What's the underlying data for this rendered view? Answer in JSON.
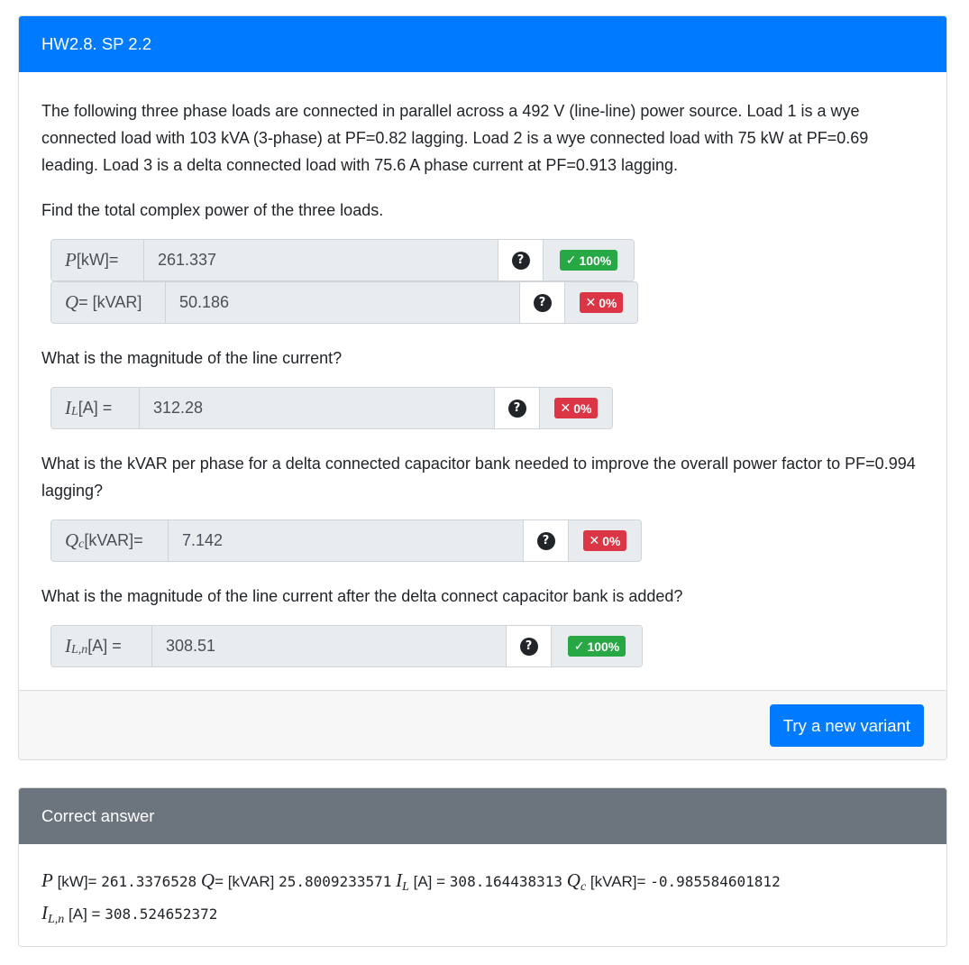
{
  "question": {
    "title": "HW2.8. SP 2.2",
    "intro": "The following three phase loads are connected in parallel across a 492 V (line-line) power source. Load 1 is a wye connected load with 103 kVA (3-phase) at PF=0.82 lagging. Load 2 is a wye connected load with 75 kW at PF=0.69 leading. Load 3 is a delta connected load with 75.6 A phase current at PF=0.913 lagging.",
    "prompt1": "Find the total complex power of the three loads.",
    "prompt2": "What is the magnitude of the line current?",
    "prompt3": "What is the kVAR per phase for a delta connected capacitor bank needed to improve the overall power factor to PF=0.994 lagging?",
    "prompt4": "What is the magnitude of the line current after the delta connect capacitor bank is added?",
    "help_icon": "?",
    "fields": {
      "p": {
        "var": "P",
        "label": "[kW]=",
        "value": "261.337",
        "score": "100%",
        "status": "correct"
      },
      "q": {
        "var": "Q",
        "label": "= [kVAR]",
        "value": "50.186",
        "score": "0%",
        "status": "incorrect"
      },
      "il": {
        "var": "I",
        "sub": "L",
        "label": "[A] =",
        "value": "312.28",
        "score": "0%",
        "status": "incorrect"
      },
      "qc": {
        "var": "Q",
        "sub": "c",
        "label": "[kVAR]=",
        "value": "7.142",
        "score": "0%",
        "status": "incorrect"
      },
      "iln": {
        "var": "I",
        "sub": "L,n",
        "label": "[A] =",
        "value": "308.51",
        "score": "100%",
        "status": "correct"
      }
    },
    "new_variant_button": "Try a new variant"
  },
  "answer": {
    "title": "Correct answer",
    "p_label": "[kW]=",
    "p_value": "261.3376528",
    "q_label": "= [kVAR]",
    "q_value": "25.8009233571",
    "il_label": "[A] =",
    "il_value": "308.164438313",
    "qc_label": "[kVAR]=",
    "qc_value": "-0.985584601812",
    "iln_label": "[A] =",
    "iln_value": "308.524652372"
  },
  "colors": {
    "primary": "#007bff",
    "secondary": "#6c757d",
    "success": "#28a745",
    "danger": "#dc3545"
  }
}
